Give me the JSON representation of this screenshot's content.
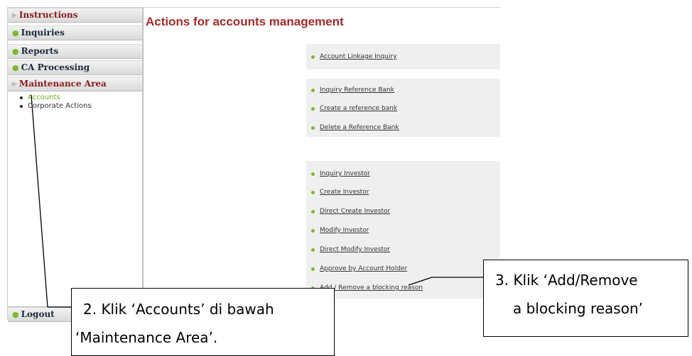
{
  "sidebar": {
    "sections": [
      {
        "label": "Instructions",
        "marker": "triangle"
      },
      {
        "label": "Inquiries",
        "marker": "dot"
      },
      {
        "label": "Reports",
        "marker": "dot"
      },
      {
        "label": "CA Processing",
        "marker": "dot"
      },
      {
        "label": "Maintenance Area",
        "marker": "triangle"
      }
    ],
    "items": [
      {
        "label": "Accounts",
        "active": true
      },
      {
        "label": "Corporate Actions",
        "active": false
      }
    ],
    "logout_label": "Logout"
  },
  "main": {
    "title": "Actions for accounts management",
    "groups": [
      {
        "links": [
          "Account Linkage Inquiry"
        ]
      },
      {
        "links": [
          "Inquiry Reference Bank",
          "Create a reference bank",
          "Delete a Reference Bank"
        ]
      },
      {
        "links": [
          "Inquiry Investor",
          "Create Investor",
          "Direct Create Investor",
          "Modify Investor",
          "Direct Modify Investor",
          "Approve by Account Holder",
          "Add / Remove a blocking reason"
        ]
      }
    ]
  },
  "annotations": {
    "step2_line1": "2. Klik ‘Accounts’ di bawah",
    "step2_line2": "‘Maintenance Area’.",
    "step3_line1": "3.  Klik  ‘Add/Remove",
    "step3_line2": "a blocking reason’"
  },
  "colors": {
    "title": "#a52a2a",
    "section_red": "#8b1a1a",
    "accent_green": "#7cb82f",
    "panel_gray": "#efefef"
  }
}
